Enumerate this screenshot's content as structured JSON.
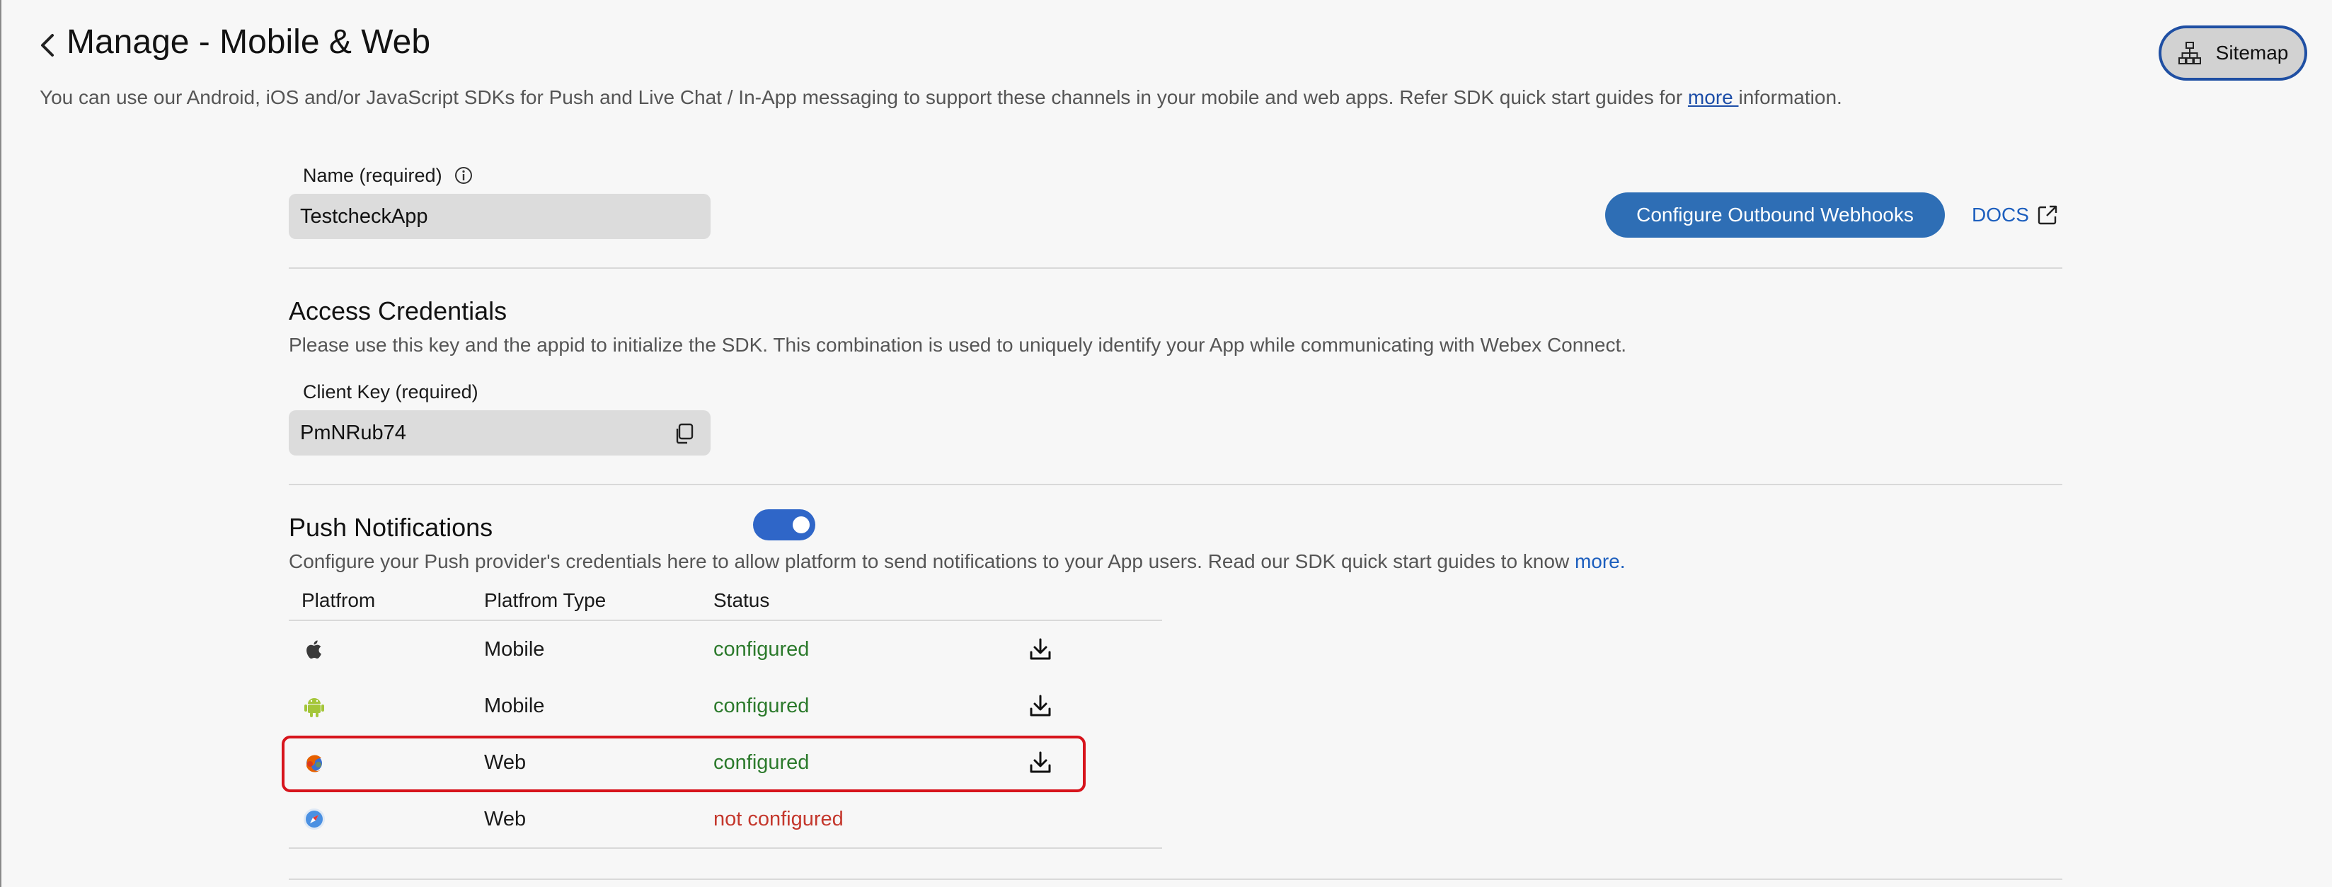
{
  "header": {
    "title": "Manage - Mobile & Web",
    "description_before": "You can use our Android, iOS and/or JavaScript SDKs for Push and Live Chat / In-App messaging to support these channels in your mobile and web apps. Refer SDK quick start guides for ",
    "description_link": "more ",
    "description_after": "information.",
    "sitemap_label": "Sitemap"
  },
  "name_field": {
    "label": "Name (required)",
    "value": "TestcheckApp"
  },
  "actions": {
    "webhooks_label": "Configure Outbound Webhooks",
    "docs_label": "DOCS"
  },
  "access": {
    "title": "Access Credentials",
    "description": "Please use this key and the appid to initialize the SDK. This combination is used to uniquely identify your App while communicating with Webex Connect.",
    "client_key_label": "Client Key (required)",
    "client_key_value": "PmNRub74"
  },
  "push": {
    "title": "Push Notifications",
    "enabled": true,
    "description_before": "Configure your Push provider's credentials here to allow platform to send notifications to your App users. Read our SDK quick start guides to know ",
    "description_link": "more."
  },
  "table": {
    "headers": [
      "Platfrom",
      "Platfrom Type",
      "Status"
    ],
    "rows": [
      {
        "icon": "apple-icon",
        "type": "Mobile",
        "status": "configured",
        "downloadable": true
      },
      {
        "icon": "android-icon",
        "type": "Mobile",
        "status": "configured",
        "downloadable": true
      },
      {
        "icon": "firefox-icon",
        "type": "Web",
        "status": "configured",
        "downloadable": true
      },
      {
        "icon": "safari-icon",
        "type": "Web",
        "status": "not configured",
        "downloadable": false
      }
    ]
  },
  "colors": {
    "accent": "#2e6eb5",
    "configured": "#2c7a2c",
    "not_configured": "#c4372c",
    "highlight": "#d7141c"
  }
}
